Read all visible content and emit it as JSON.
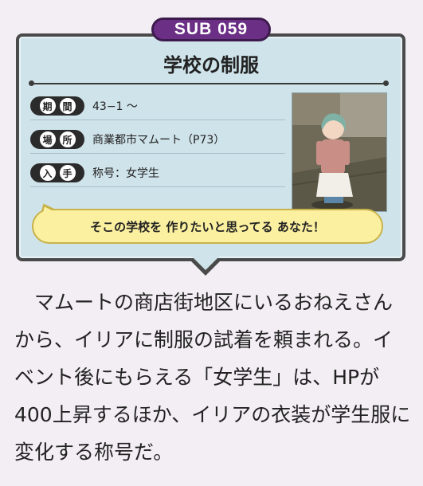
{
  "badge": "SUB 059",
  "title": "学校の制服",
  "rows": [
    {
      "label": [
        "期",
        "間"
      ],
      "value": "43−1 ～"
    },
    {
      "label": [
        "場",
        "所"
      ],
      "value": "商業都市マムート（P73）"
    },
    {
      "label": [
        "入",
        "手"
      ],
      "value": "称号：女学生"
    }
  ],
  "speech": "そこの学校を 作りたいと思ってる あなた！",
  "body": "　マムートの商店街地区にいるおねえさんから、イリアに制服の試着を頼まれる。イベント後にもらえる「女学生」は、HPが400上昇するほか、イリアの衣装が学生服に変化する称号だ。",
  "colors": {
    "card_bg": "#cfe3ea",
    "badge_bg": "#6b2f86",
    "speech_bg": "#fbf0a0",
    "page_bg": "#f3eef4"
  }
}
